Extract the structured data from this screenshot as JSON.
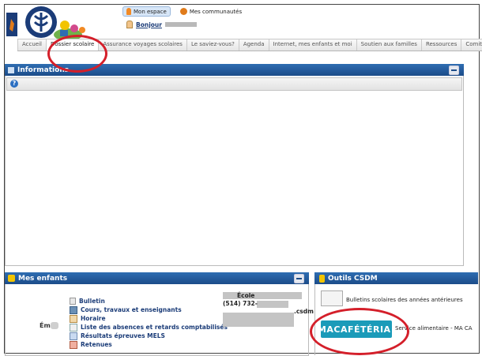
{
  "topbar": {
    "mon_espace": "Mon espace",
    "mes_communautes": "Mes communautés",
    "hello_prefix": "Bonjour"
  },
  "tabs": [
    {
      "label": "Accueil"
    },
    {
      "label": "Dossier scolaire",
      "active": true
    },
    {
      "label": "Assurance voyages scolaires"
    },
    {
      "label": "Le saviez-vous?"
    },
    {
      "label": "Agenda"
    },
    {
      "label": "Internet, mes enfants et moi"
    },
    {
      "label": "Soutien aux familles"
    },
    {
      "label": "Ressources"
    },
    {
      "label": "Comité"
    }
  ],
  "informations": {
    "title": "Informations"
  },
  "mes_enfants": {
    "title": "Mes enfants",
    "child_name": "Ém",
    "menu": [
      {
        "label": "Bulletin",
        "icon": "report-icon"
      },
      {
        "label": "Cours, travaux et enseignants",
        "icon": "book-icon"
      },
      {
        "label": "Horaire",
        "icon": "calendar-icon"
      },
      {
        "label": "Liste des absences et retards comptabilisés",
        "icon": "list-icon"
      },
      {
        "label": "Résultats épreuves MELS",
        "icon": "results-icon"
      },
      {
        "label": "Retenues",
        "icon": "detention-icon"
      }
    ],
    "school_label": "École",
    "phone": "(514) 732-",
    "email_suffix": ".csdm"
  },
  "outils": {
    "title": "Outils CSDM",
    "items": [
      {
        "label": "Bulletins scolaires des années antérieures"
      },
      {
        "label": "Service alimentaire - MA CA"
      }
    ],
    "cafeteria_logo": "MACAFÉTÉRIA!"
  },
  "colors": {
    "panel_header": "#1c4c89",
    "annotation_red": "#d41f2a",
    "cafeteria": "#1b9bb9"
  }
}
